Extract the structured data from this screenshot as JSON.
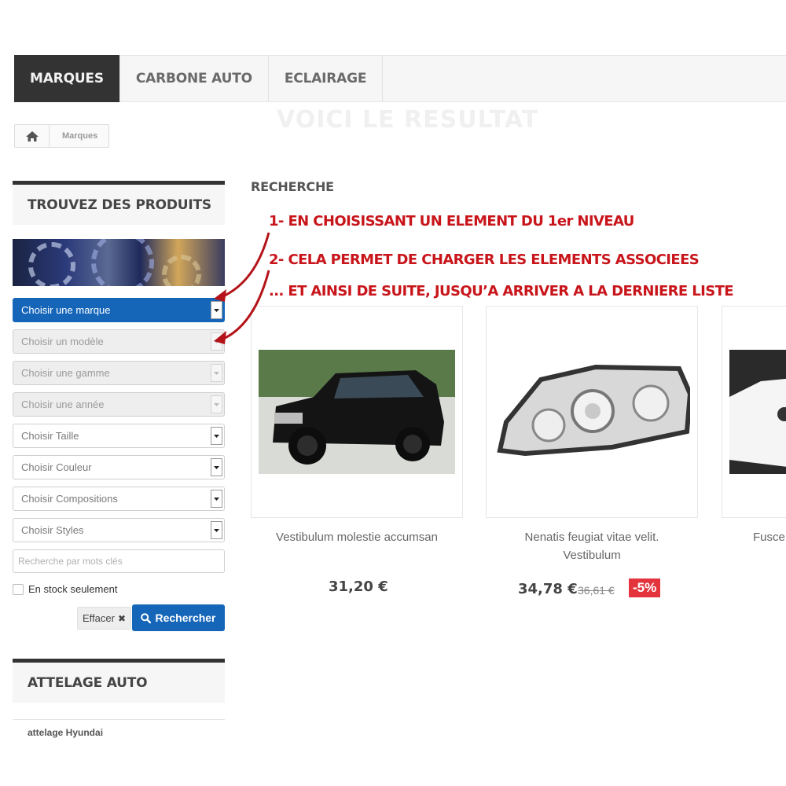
{
  "nav": {
    "tabs": [
      {
        "label": "MARQUES",
        "active": true
      },
      {
        "label": "CARBONE AUTO",
        "active": false
      },
      {
        "label": "ECLAIRAGE",
        "active": false
      }
    ]
  },
  "breadcrumb": {
    "icon": "home-icon",
    "current": "Marques"
  },
  "ghost_title": "VOICI LE RESULTAT",
  "sidebar": {
    "finder_title": "TROUVEZ DES PRODUITS",
    "selects": [
      {
        "label": "Choisir une marque",
        "state": "active"
      },
      {
        "label": "Choisir un modèle",
        "state": "disabled"
      },
      {
        "label": "Choisir une gamme",
        "state": "disabled"
      },
      {
        "label": "Choisir une année",
        "state": "disabled"
      },
      {
        "label": "Choisir Taille",
        "state": "enabled"
      },
      {
        "label": "Choisir Couleur",
        "state": "enabled"
      },
      {
        "label": "Choisir Compositions",
        "state": "enabled"
      },
      {
        "label": "Choisir Styles",
        "state": "enabled"
      }
    ],
    "keyword_placeholder": "Recherche par mots clés",
    "stock_label": "En stock seulement",
    "clear_label": "Effacer",
    "search_label": "Rechercher",
    "attelage_title": "ATTELAGE AUTO",
    "attelage_item": "attelage Hyundai"
  },
  "main": {
    "section_title": "RECHERCHE",
    "notes": [
      "1- EN CHOISISSANT UN ELEMENT  DU 1er NIVEAU",
      "2- CELA PERMET DE CHARGER LES  ELEMENTS ASSOCIEES",
      "... ET AINSI DE SUITE, JUSQU’A ARRIVER A LA DERNIERE LISTE"
    ],
    "products": [
      {
        "name_line1": "Vestibulum molestie accumsan",
        "name_line2": "",
        "price": "31,20 €"
      },
      {
        "name_line1": "Nenatis feugiat vitae velit.",
        "name_line2": "Vestibulum",
        "price": "34,78 €",
        "old_price": "36,61 €",
        "discount": "-5%"
      },
      {
        "name_line1": "Fusce",
        "name_line2": "",
        "price": ""
      }
    ]
  },
  "colors": {
    "accent": "#1565b8",
    "dark": "#333333",
    "annotation": "#c8151b",
    "discount": "#e3343e"
  }
}
